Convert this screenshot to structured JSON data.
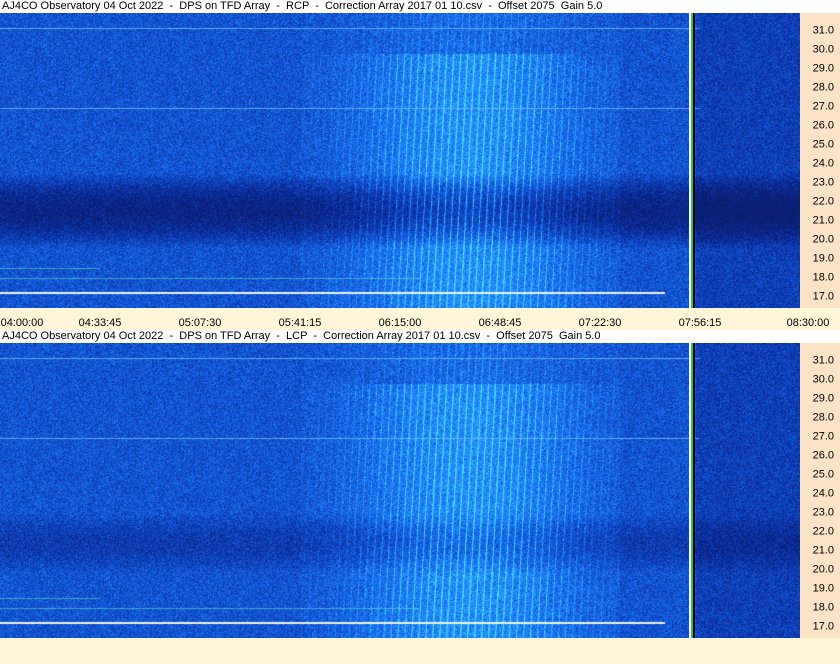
{
  "panels": [
    {
      "id": "rcp",
      "title": "AJ4CO Observatory 04 Oct 2022  -  DPS on TFD Array  -  RCP  -  Correction Array 2017 01 10.csv  -  Offset 2075  Gain 5.0"
    },
    {
      "id": "lcp",
      "title": "AJ4CO Observatory 04 Oct 2022  -  DPS on TFD Array  -  LCP  -  Correction Array 2017 01 10.csv  -  Offset 2075  Gain 5.0"
    }
  ],
  "freq_axis": {
    "labels": [
      "31.0",
      "30.0",
      "29.0",
      "28.0",
      "27.0",
      "26.0",
      "25.0",
      "24.0",
      "23.0",
      "22.0",
      "21.0",
      "20.0",
      "19.0",
      "18.0",
      "17.0"
    ]
  },
  "time_axis": {
    "labels": [
      "04:00:00",
      "04:33:45",
      "05:07:30",
      "05:41:15",
      "06:15:00",
      "06:48:45",
      "07:22:30",
      "07:56:15",
      "08:30:00"
    ]
  },
  "colors": {
    "background": "#0a2a9a",
    "axis_bg": "#fbe3c8",
    "page_bg": "#fdf6d8",
    "burst": "#40e0c0"
  }
}
